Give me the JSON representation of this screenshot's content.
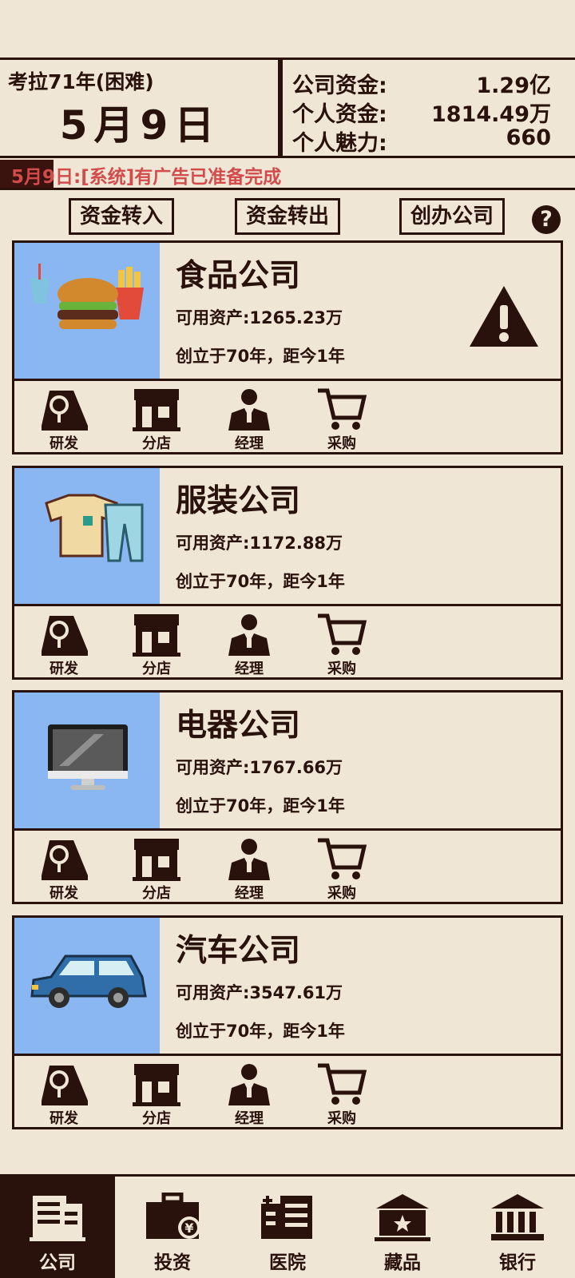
{
  "header": {
    "era_label": "考拉71年(困难)",
    "date": "5月9日",
    "stats": [
      {
        "label": "公司资金:",
        "value": "1.29亿"
      },
      {
        "label": "个人资金:",
        "value": "1814.49万"
      },
      {
        "label": "个人魅力:",
        "value": "660"
      }
    ]
  },
  "news": {
    "text": "5月9日:[系统]有广告已准备完成"
  },
  "actions": {
    "transfer_in": "资金转入",
    "transfer_out": "资金转出",
    "found_company": "创办公司",
    "help": "?"
  },
  "companies": [
    {
      "name": "食品公司",
      "assets": "可用资产:1265.23万",
      "founded": "创立于70年，距今1年",
      "icon": "burger-icon",
      "warning": true
    },
    {
      "name": "服装公司",
      "assets": "可用资产:1172.88万",
      "founded": "创立于70年，距今1年",
      "icon": "clothes-icon"
    },
    {
      "name": "电器公司",
      "assets": "可用资产:1767.66万",
      "founded": "创立于70年，距今1年",
      "icon": "monitor-icon"
    },
    {
      "name": "汽车公司",
      "assets": "可用资产:3547.61万",
      "founded": "创立于70年，距今1年",
      "icon": "car-icon"
    }
  ],
  "company_actions": [
    "研发",
    "分店",
    "经理",
    "采购"
  ],
  "tabs": [
    {
      "label": "公司",
      "active": true
    },
    {
      "label": "投资"
    },
    {
      "label": "医院"
    },
    {
      "label": "藏品"
    },
    {
      "label": "银行"
    }
  ],
  "colors": {
    "background": "#efe6d6",
    "ink": "#2a120c",
    "thumb": "#8ab6f2",
    "news": "#d24c4c"
  }
}
